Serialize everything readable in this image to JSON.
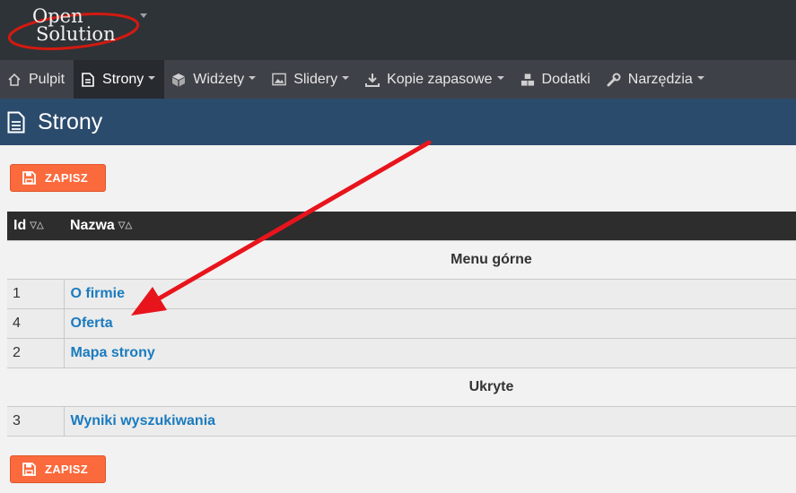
{
  "logo": {
    "line1": "Open",
    "line2": "Solution"
  },
  "nav": {
    "items": [
      {
        "label": "Pulpit",
        "icon": "home-icon",
        "dropdown": false,
        "active": false
      },
      {
        "label": "Strony",
        "icon": "file-icon",
        "dropdown": true,
        "active": true
      },
      {
        "label": "Widżety",
        "icon": "cube-icon",
        "dropdown": true,
        "active": false
      },
      {
        "label": "Slidery",
        "icon": "image-icon",
        "dropdown": true,
        "active": false
      },
      {
        "label": "Kopie zapasowe",
        "icon": "download-icon",
        "dropdown": true,
        "active": false
      },
      {
        "label": "Dodatki",
        "icon": "cubes-icon",
        "dropdown": false,
        "active": false
      },
      {
        "label": "Narzędzia",
        "icon": "wrench-icon",
        "dropdown": true,
        "active": false
      }
    ]
  },
  "page": {
    "title": "Strony"
  },
  "buttons": {
    "save_label": "ZAPISZ"
  },
  "table": {
    "headers": {
      "id": "Id",
      "name": "Nazwa"
    },
    "groups": [
      {
        "title": "Menu górne",
        "rows": [
          {
            "id": "1",
            "name": "O firmie"
          },
          {
            "id": "4",
            "name": "Oferta"
          },
          {
            "id": "2",
            "name": "Mapa strony"
          }
        ]
      },
      {
        "title": "Ukryte",
        "rows": [
          {
            "id": "3",
            "name": "Wyniki wyszukiwania"
          }
        ]
      }
    ]
  },
  "colors": {
    "topbar": "#2e3338",
    "nav": "#3e4147",
    "page_header": "#2b4b6c",
    "save_button": "#fa6a3c",
    "link": "#1a7bbf",
    "annotation_arrow": "#e8141c"
  }
}
